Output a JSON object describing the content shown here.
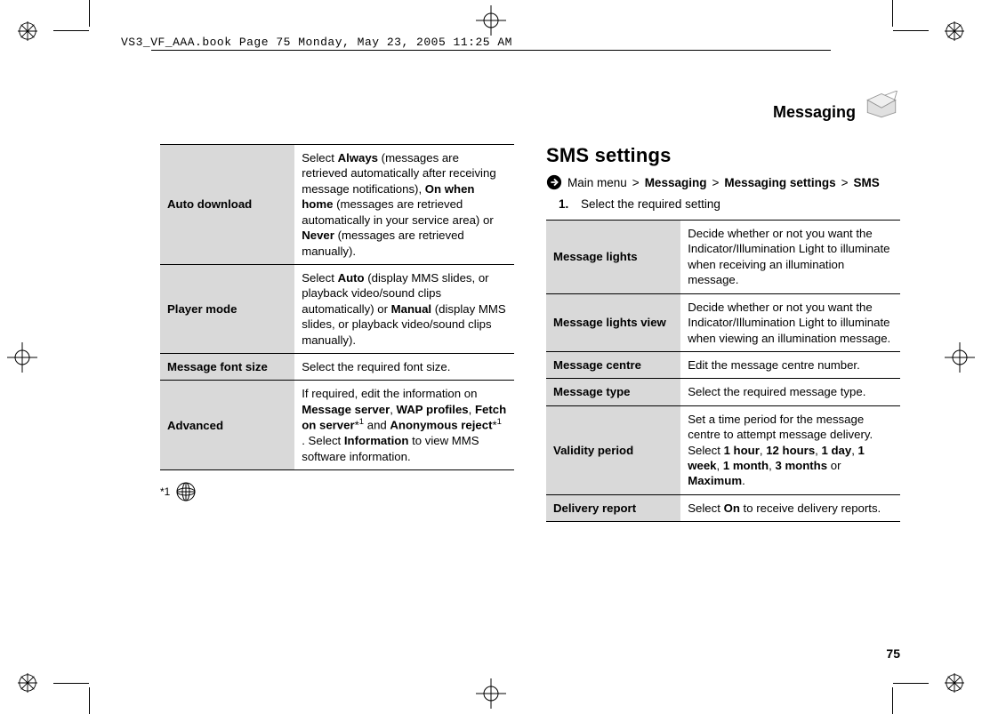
{
  "book_meta": "VS3_VF_AAA.book  Page 75  Monday, May 23, 2005  11:25 AM",
  "page_number": "75",
  "section_header": "Messaging",
  "left_table": [
    {
      "key": "Auto download",
      "val_parts": [
        "Select ",
        "Always",
        " (messages are retrieved automatically after receiving message notifications), ",
        "On when home",
        " (messages are retrieved automatically in your service area) or ",
        "Never",
        " (messages are retrieved manually)."
      ],
      "bold_idx": [
        1,
        3,
        5
      ]
    },
    {
      "key": "Player mode",
      "val_parts": [
        "Select ",
        "Auto",
        " (display MMS slides, or playback video/sound clips automatically) or ",
        "Manual",
        " (display MMS slides, or playback video/sound clips manually)."
      ],
      "bold_idx": [
        1,
        3
      ]
    },
    {
      "key": "Message font size",
      "val_parts": [
        "Select the required font size."
      ],
      "bold_idx": []
    },
    {
      "key": "Advanced",
      "val_parts": [
        "If required, edit the information on ",
        "Message server",
        ", ",
        "WAP profiles",
        ", ",
        "Fetch on server",
        "*",
        "and ",
        "Anonymous reject",
        "*",
        ". Select ",
        "Information",
        " to view MMS software information."
      ],
      "bold_idx": [
        1,
        3,
        5,
        8,
        11
      ],
      "sup_after_idx": [
        6,
        9
      ]
    }
  ],
  "footnote_marker": "*1",
  "right": {
    "heading": "SMS settings",
    "breadcrumb": {
      "prefix": "Main menu",
      "parts": [
        "Messaging",
        "Messaging settings",
        "SMS"
      ]
    },
    "step_num": "1.",
    "step_text": "Select the required setting",
    "table": [
      {
        "key": "Message lights",
        "val": "Decide whether or not you want the Indicator/Illumination Light to illuminate when receiving an illumination message."
      },
      {
        "key": "Message lights view",
        "val": "Decide whether or not you want the Indicator/Illumination Light to illuminate when viewing an illumination message."
      },
      {
        "key": "Message centre",
        "val": "Edit the message centre number."
      },
      {
        "key": "Message type",
        "val": "Select the required message type."
      },
      {
        "key": "Validity period",
        "val_parts": [
          "Set a time period for the message centre to attempt message delivery. Select ",
          "1 hour",
          ", ",
          "12 hours",
          ", ",
          "1 day",
          ", ",
          "1 week",
          ", ",
          "1 month",
          ", ",
          "3 months",
          " or ",
          "Maximum",
          "."
        ],
        "bold_idx": [
          1,
          3,
          5,
          7,
          9,
          11,
          13
        ]
      },
      {
        "key": "Delivery report",
        "val_parts": [
          "Select ",
          "On",
          " to receive delivery reports."
        ],
        "bold_idx": [
          1
        ]
      }
    ]
  }
}
